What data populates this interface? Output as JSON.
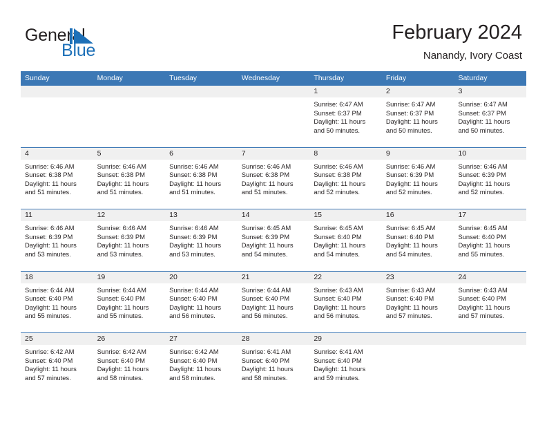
{
  "brand": {
    "name_part1": "General",
    "name_part2": "Blue",
    "mark_icon": "triangle-flag-icon",
    "accent_color": "#1d70b8"
  },
  "header": {
    "title": "February 2024",
    "subtitle": "Nanandy, Ivory Coast"
  },
  "calendar": {
    "header_color": "#3c78b5",
    "weekdays": [
      "Sunday",
      "Monday",
      "Tuesday",
      "Wednesday",
      "Thursday",
      "Friday",
      "Saturday"
    ],
    "weeks": [
      [
        {
          "day": "",
          "sunrise": "",
          "sunset": "",
          "daylight_line1": "",
          "daylight_line2": ""
        },
        {
          "day": "",
          "sunrise": "",
          "sunset": "",
          "daylight_line1": "",
          "daylight_line2": ""
        },
        {
          "day": "",
          "sunrise": "",
          "sunset": "",
          "daylight_line1": "",
          "daylight_line2": ""
        },
        {
          "day": "",
          "sunrise": "",
          "sunset": "",
          "daylight_line1": "",
          "daylight_line2": ""
        },
        {
          "day": "1",
          "sunrise": "Sunrise: 6:47 AM",
          "sunset": "Sunset: 6:37 PM",
          "daylight_line1": "Daylight: 11 hours",
          "daylight_line2": "and 50 minutes."
        },
        {
          "day": "2",
          "sunrise": "Sunrise: 6:47 AM",
          "sunset": "Sunset: 6:37 PM",
          "daylight_line1": "Daylight: 11 hours",
          "daylight_line2": "and 50 minutes."
        },
        {
          "day": "3",
          "sunrise": "Sunrise: 6:47 AM",
          "sunset": "Sunset: 6:37 PM",
          "daylight_line1": "Daylight: 11 hours",
          "daylight_line2": "and 50 minutes."
        }
      ],
      [
        {
          "day": "4",
          "sunrise": "Sunrise: 6:46 AM",
          "sunset": "Sunset: 6:38 PM",
          "daylight_line1": "Daylight: 11 hours",
          "daylight_line2": "and 51 minutes."
        },
        {
          "day": "5",
          "sunrise": "Sunrise: 6:46 AM",
          "sunset": "Sunset: 6:38 PM",
          "daylight_line1": "Daylight: 11 hours",
          "daylight_line2": "and 51 minutes."
        },
        {
          "day": "6",
          "sunrise": "Sunrise: 6:46 AM",
          "sunset": "Sunset: 6:38 PM",
          "daylight_line1": "Daylight: 11 hours",
          "daylight_line2": "and 51 minutes."
        },
        {
          "day": "7",
          "sunrise": "Sunrise: 6:46 AM",
          "sunset": "Sunset: 6:38 PM",
          "daylight_line1": "Daylight: 11 hours",
          "daylight_line2": "and 51 minutes."
        },
        {
          "day": "8",
          "sunrise": "Sunrise: 6:46 AM",
          "sunset": "Sunset: 6:38 PM",
          "daylight_line1": "Daylight: 11 hours",
          "daylight_line2": "and 52 minutes."
        },
        {
          "day": "9",
          "sunrise": "Sunrise: 6:46 AM",
          "sunset": "Sunset: 6:39 PM",
          "daylight_line1": "Daylight: 11 hours",
          "daylight_line2": "and 52 minutes."
        },
        {
          "day": "10",
          "sunrise": "Sunrise: 6:46 AM",
          "sunset": "Sunset: 6:39 PM",
          "daylight_line1": "Daylight: 11 hours",
          "daylight_line2": "and 52 minutes."
        }
      ],
      [
        {
          "day": "11",
          "sunrise": "Sunrise: 6:46 AM",
          "sunset": "Sunset: 6:39 PM",
          "daylight_line1": "Daylight: 11 hours",
          "daylight_line2": "and 53 minutes."
        },
        {
          "day": "12",
          "sunrise": "Sunrise: 6:46 AM",
          "sunset": "Sunset: 6:39 PM",
          "daylight_line1": "Daylight: 11 hours",
          "daylight_line2": "and 53 minutes."
        },
        {
          "day": "13",
          "sunrise": "Sunrise: 6:46 AM",
          "sunset": "Sunset: 6:39 PM",
          "daylight_line1": "Daylight: 11 hours",
          "daylight_line2": "and 53 minutes."
        },
        {
          "day": "14",
          "sunrise": "Sunrise: 6:45 AM",
          "sunset": "Sunset: 6:39 PM",
          "daylight_line1": "Daylight: 11 hours",
          "daylight_line2": "and 54 minutes."
        },
        {
          "day": "15",
          "sunrise": "Sunrise: 6:45 AM",
          "sunset": "Sunset: 6:40 PM",
          "daylight_line1": "Daylight: 11 hours",
          "daylight_line2": "and 54 minutes."
        },
        {
          "day": "16",
          "sunrise": "Sunrise: 6:45 AM",
          "sunset": "Sunset: 6:40 PM",
          "daylight_line1": "Daylight: 11 hours",
          "daylight_line2": "and 54 minutes."
        },
        {
          "day": "17",
          "sunrise": "Sunrise: 6:45 AM",
          "sunset": "Sunset: 6:40 PM",
          "daylight_line1": "Daylight: 11 hours",
          "daylight_line2": "and 55 minutes."
        }
      ],
      [
        {
          "day": "18",
          "sunrise": "Sunrise: 6:44 AM",
          "sunset": "Sunset: 6:40 PM",
          "daylight_line1": "Daylight: 11 hours",
          "daylight_line2": "and 55 minutes."
        },
        {
          "day": "19",
          "sunrise": "Sunrise: 6:44 AM",
          "sunset": "Sunset: 6:40 PM",
          "daylight_line1": "Daylight: 11 hours",
          "daylight_line2": "and 55 minutes."
        },
        {
          "day": "20",
          "sunrise": "Sunrise: 6:44 AM",
          "sunset": "Sunset: 6:40 PM",
          "daylight_line1": "Daylight: 11 hours",
          "daylight_line2": "and 56 minutes."
        },
        {
          "day": "21",
          "sunrise": "Sunrise: 6:44 AM",
          "sunset": "Sunset: 6:40 PM",
          "daylight_line1": "Daylight: 11 hours",
          "daylight_line2": "and 56 minutes."
        },
        {
          "day": "22",
          "sunrise": "Sunrise: 6:43 AM",
          "sunset": "Sunset: 6:40 PM",
          "daylight_line1": "Daylight: 11 hours",
          "daylight_line2": "and 56 minutes."
        },
        {
          "day": "23",
          "sunrise": "Sunrise: 6:43 AM",
          "sunset": "Sunset: 6:40 PM",
          "daylight_line1": "Daylight: 11 hours",
          "daylight_line2": "and 57 minutes."
        },
        {
          "day": "24",
          "sunrise": "Sunrise: 6:43 AM",
          "sunset": "Sunset: 6:40 PM",
          "daylight_line1": "Daylight: 11 hours",
          "daylight_line2": "and 57 minutes."
        }
      ],
      [
        {
          "day": "25",
          "sunrise": "Sunrise: 6:42 AM",
          "sunset": "Sunset: 6:40 PM",
          "daylight_line1": "Daylight: 11 hours",
          "daylight_line2": "and 57 minutes."
        },
        {
          "day": "26",
          "sunrise": "Sunrise: 6:42 AM",
          "sunset": "Sunset: 6:40 PM",
          "daylight_line1": "Daylight: 11 hours",
          "daylight_line2": "and 58 minutes."
        },
        {
          "day": "27",
          "sunrise": "Sunrise: 6:42 AM",
          "sunset": "Sunset: 6:40 PM",
          "daylight_line1": "Daylight: 11 hours",
          "daylight_line2": "and 58 minutes."
        },
        {
          "day": "28",
          "sunrise": "Sunrise: 6:41 AM",
          "sunset": "Sunset: 6:40 PM",
          "daylight_line1": "Daylight: 11 hours",
          "daylight_line2": "and 58 minutes."
        },
        {
          "day": "29",
          "sunrise": "Sunrise: 6:41 AM",
          "sunset": "Sunset: 6:40 PM",
          "daylight_line1": "Daylight: 11 hours",
          "daylight_line2": "and 59 minutes."
        },
        {
          "day": "",
          "sunrise": "",
          "sunset": "",
          "daylight_line1": "",
          "daylight_line2": ""
        },
        {
          "day": "",
          "sunrise": "",
          "sunset": "",
          "daylight_line1": "",
          "daylight_line2": ""
        }
      ]
    ]
  }
}
